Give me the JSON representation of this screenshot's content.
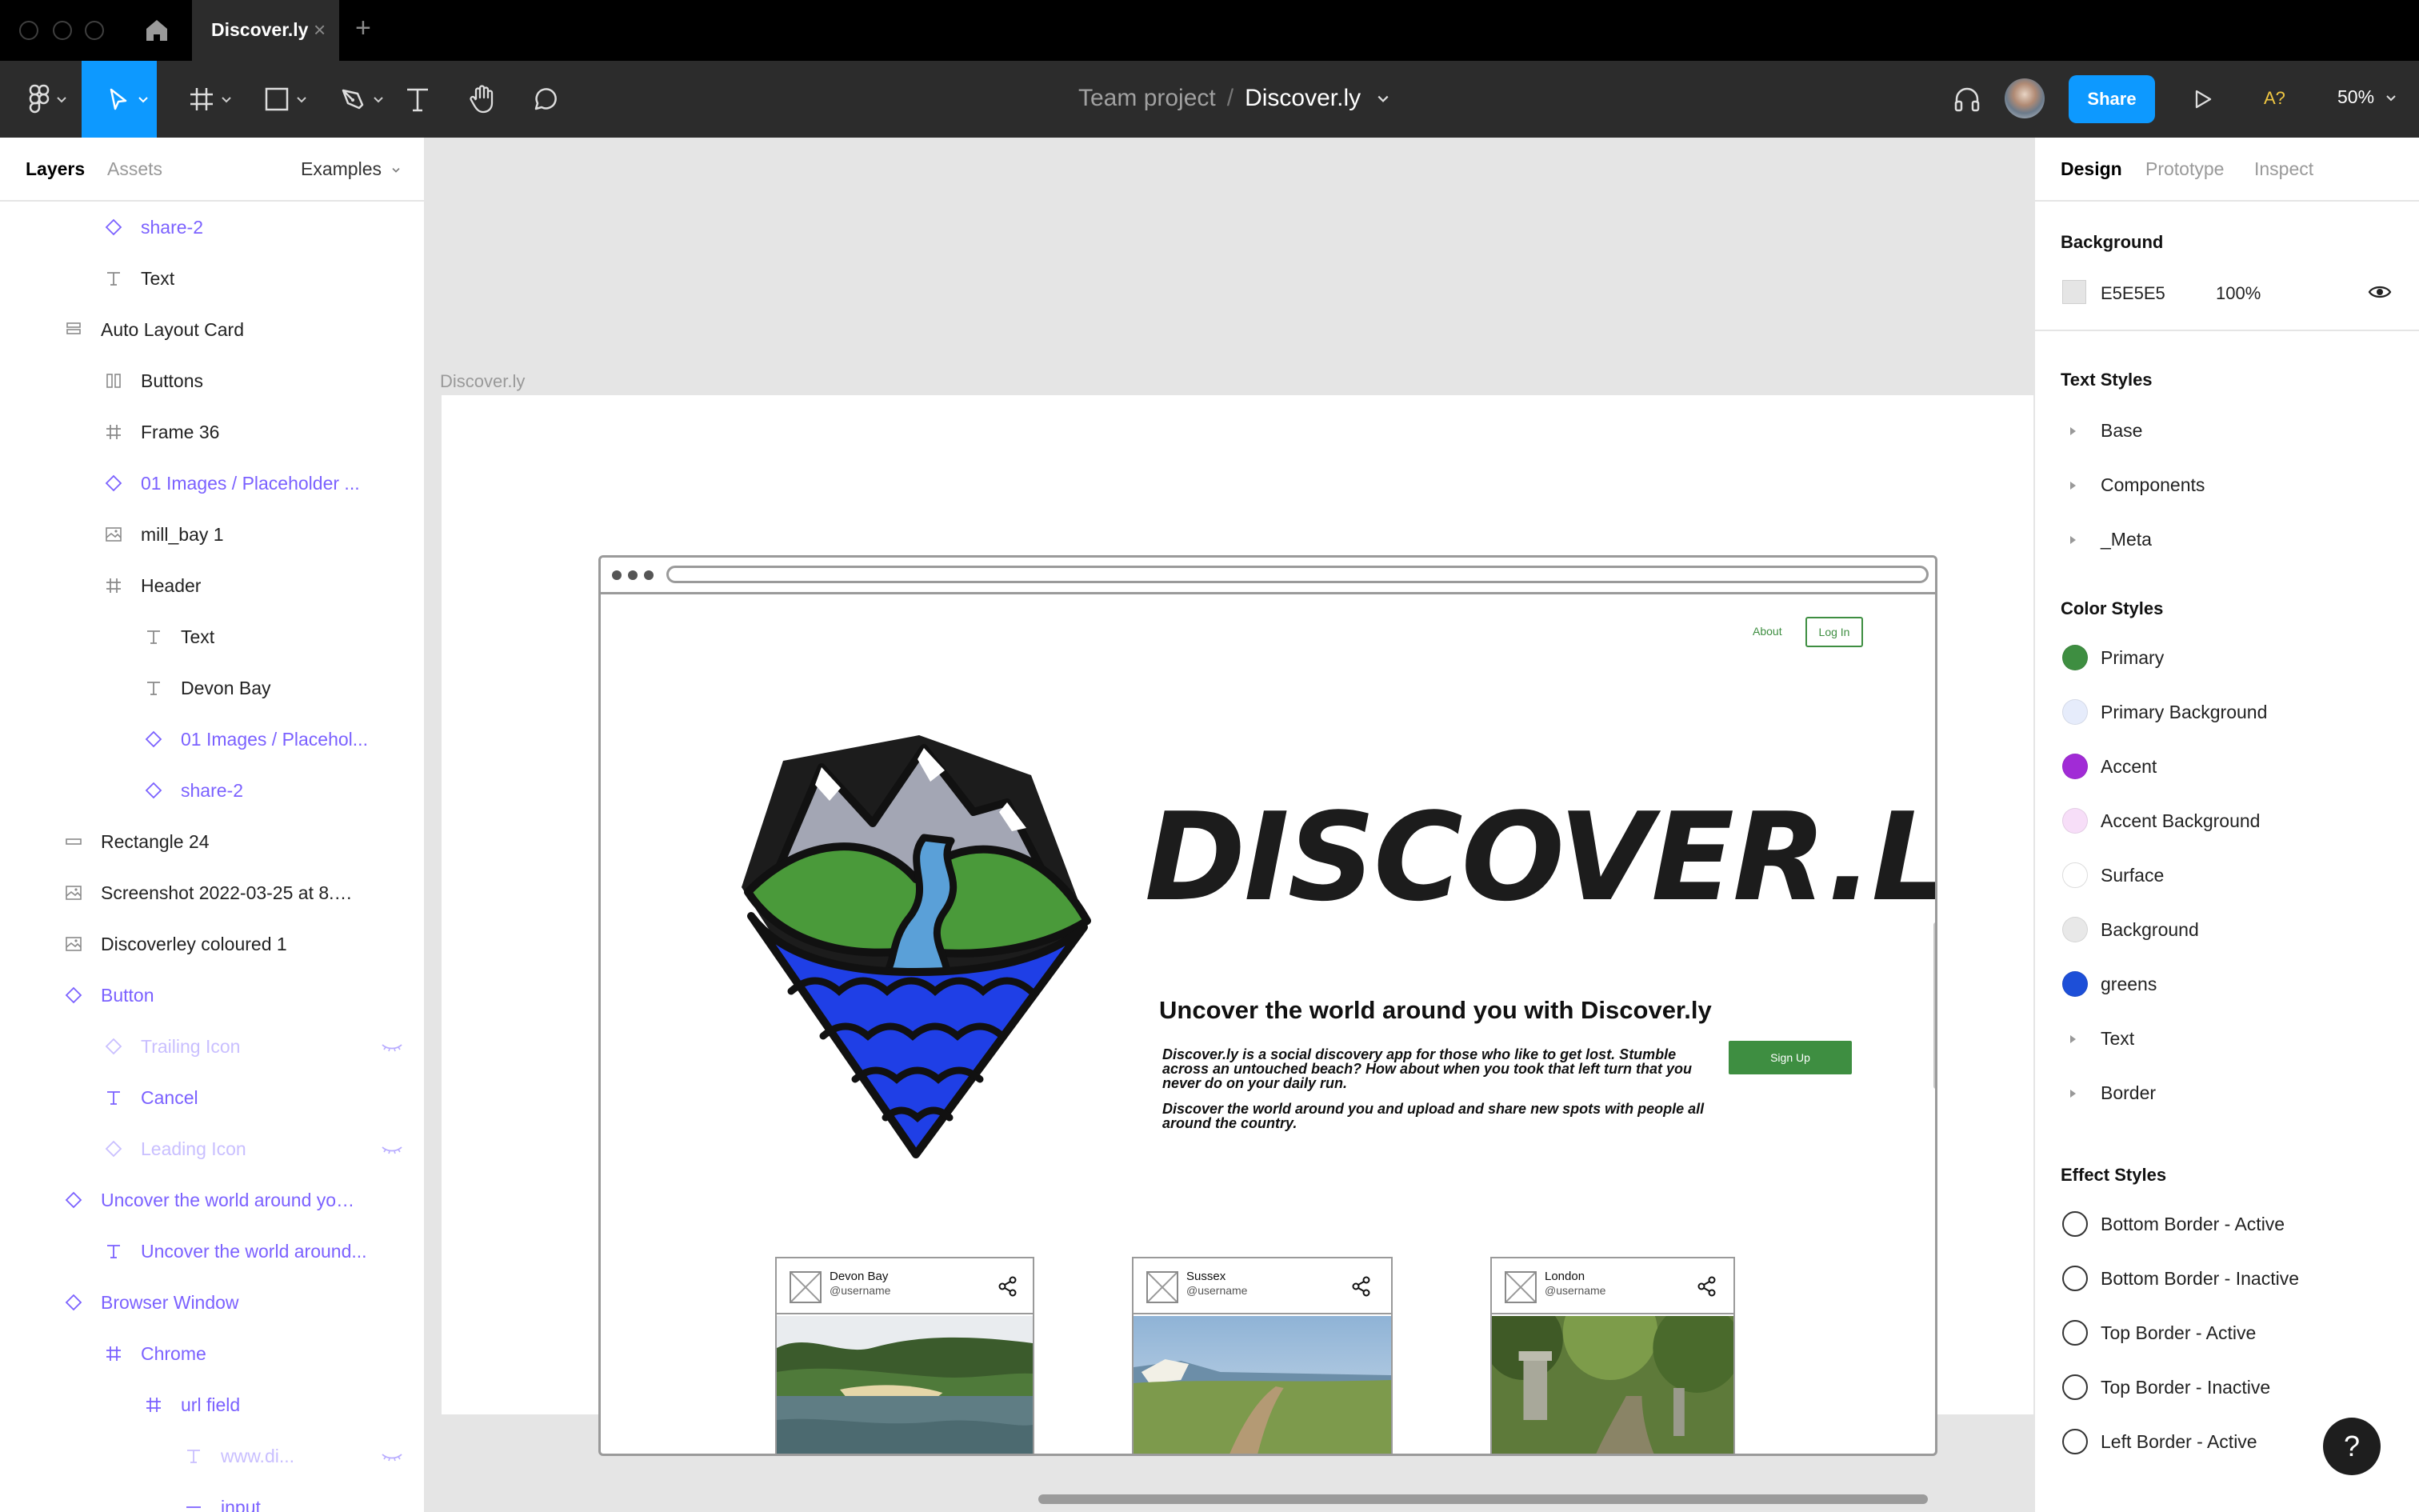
{
  "window": {
    "tab_title": "Discover.ly",
    "tab_close": "×",
    "tab_add": "+"
  },
  "toolbar": {
    "project": "Team project",
    "separator": "/",
    "file": "Discover.ly",
    "share_label": "Share",
    "font_check": "A?",
    "zoom": "50%"
  },
  "left_panel": {
    "tabs": {
      "layers": "Layers",
      "assets": "Assets",
      "page": "Examples"
    },
    "layers": [
      {
        "label": "share-2",
        "type": "component",
        "indent": 2
      },
      {
        "label": "Text",
        "type": "text",
        "indent": 2
      },
      {
        "label": "Auto Layout Card",
        "type": "autolayout",
        "indent": 1
      },
      {
        "label": "Buttons",
        "type": "columns",
        "indent": 2
      },
      {
        "label": "Frame 36",
        "type": "frame",
        "indent": 2
      },
      {
        "label": "01 Images / Placeholder ...",
        "type": "component",
        "indent": 2
      },
      {
        "label": "mill_bay 1",
        "type": "image",
        "indent": 2
      },
      {
        "label": "Header",
        "type": "frame",
        "indent": 2
      },
      {
        "label": "Text",
        "type": "text",
        "indent": 3
      },
      {
        "label": "Devon Bay",
        "type": "text",
        "indent": 3
      },
      {
        "label": "01 Images / Placehol...",
        "type": "component",
        "indent": 3
      },
      {
        "label": "share-2",
        "type": "component",
        "indent": 3
      },
      {
        "label": "Rectangle 24",
        "type": "rectangle",
        "indent": 1
      },
      {
        "label": "Screenshot 2022-03-25 at 8.5...",
        "type": "image",
        "indent": 1
      },
      {
        "label": "Discoverley coloured 1",
        "type": "image",
        "indent": 1
      },
      {
        "label": "Button",
        "type": "component",
        "indent": 1
      },
      {
        "label": "Trailing Icon",
        "type": "component-hidden",
        "indent": 2
      },
      {
        "label": "Cancel",
        "type": "text-comp",
        "indent": 2
      },
      {
        "label": "Leading Icon",
        "type": "component-hidden",
        "indent": 2
      },
      {
        "label": "Uncover the world around you...",
        "type": "component",
        "indent": 1
      },
      {
        "label": "Uncover the world around...",
        "type": "text-comp",
        "indent": 2
      },
      {
        "label": "Browser Window",
        "type": "component",
        "indent": 1
      },
      {
        "label": "Chrome",
        "type": "frame-comp",
        "indent": 2
      },
      {
        "label": "url field",
        "type": "frame-comp",
        "indent": 3
      },
      {
        "label": "www.di...",
        "type": "text-hidden",
        "indent": 4
      },
      {
        "label": "input",
        "type": "line-comp",
        "indent": 4
      }
    ]
  },
  "canvas": {
    "frame_label": "Discover.ly",
    "site": {
      "nav_about": "About",
      "nav_login": "Log In",
      "wordmark": "DISCOVER.LY",
      "heading": "Uncover the world around you with Discover.ly",
      "description_1": "Discover.ly is a social discovery app for those who like to get lost. Stumble across an untouched beach? How about when you took that left turn that you never do on your daily run.",
      "description_2": "Discover the world around you and upload and share new spots with people all around the country.",
      "signup": "Sign Up",
      "cards": [
        {
          "place": "Devon Bay",
          "user": "@username"
        },
        {
          "place": "Sussex",
          "user": "@username"
        },
        {
          "place": "London",
          "user": "@username"
        }
      ]
    }
  },
  "right_panel": {
    "tabs": {
      "design": "Design",
      "prototype": "Prototype",
      "inspect": "Inspect"
    },
    "background": {
      "title": "Background",
      "hex": "E5E5E5",
      "opacity": "100%",
      "color": "#e5e5e5"
    },
    "text_styles": {
      "title": "Text Styles",
      "items": [
        "Base",
        "Components",
        "_Meta"
      ]
    },
    "color_styles": {
      "title": "Color Styles",
      "items": [
        {
          "label": "Primary",
          "color": "#3e8e41"
        },
        {
          "label": "Primary Background",
          "color": "#e6ecfb"
        },
        {
          "label": "Accent",
          "color": "#a12bd6"
        },
        {
          "label": "Accent Background",
          "color": "#f7def8"
        },
        {
          "label": "Surface",
          "color": "#ffffff"
        },
        {
          "label": "Background",
          "color": "#e8e8e8"
        },
        {
          "label": "greens",
          "color": "#1d4fd8"
        },
        {
          "label": "Text",
          "color": null
        },
        {
          "label": "Border",
          "color": null
        }
      ]
    },
    "effect_styles": {
      "title": "Effect Styles",
      "items": [
        "Bottom Border - Active",
        "Bottom Border - Inactive",
        "Top Border - Active",
        "Top Border - Inactive",
        "Left Border - Active"
      ]
    }
  },
  "help": "?"
}
